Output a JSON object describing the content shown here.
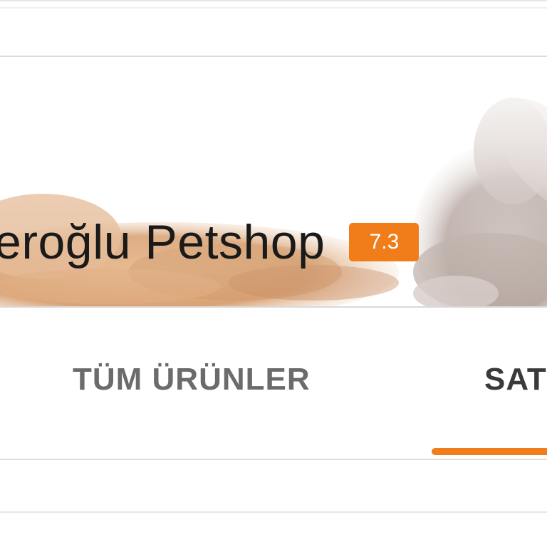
{
  "store": {
    "name": "eroğlu Petshop",
    "rating": "7.3"
  },
  "tabs": [
    {
      "label": "TÜM ÜRÜNLER",
      "active": false
    },
    {
      "label": "SAT",
      "active": true
    }
  ],
  "colors": {
    "accent": "#f07d1a",
    "title_text": "#1a1a1a",
    "tab_inactive": "#6b6b6b",
    "tab_active": "#3a3a3a"
  },
  "banner": {
    "image_subject": "dog-and-cat-banner"
  }
}
